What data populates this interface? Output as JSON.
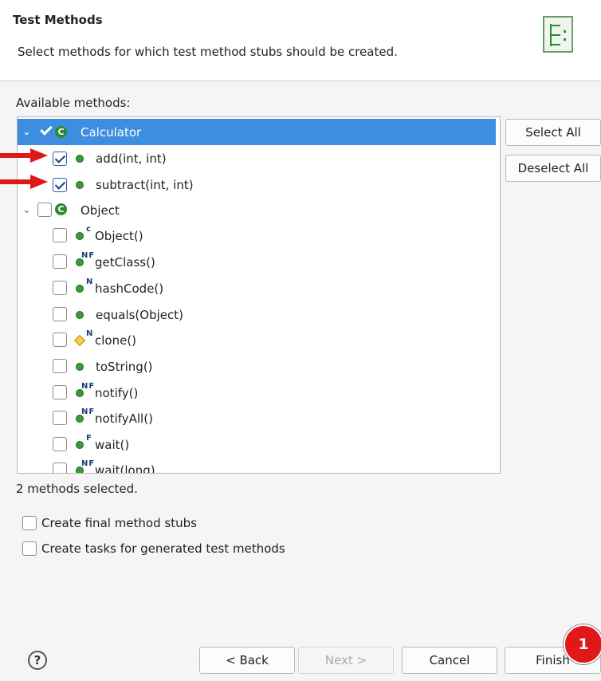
{
  "header": {
    "title": "Test Methods",
    "description": "Select methods for which test method stubs should be created."
  },
  "available_label": "Available methods:",
  "tree": [
    {
      "label": "Calculator",
      "kind": "class",
      "checked": true,
      "expanded": true,
      "selected": true
    },
    {
      "label": "add(int, int)",
      "kind": "method",
      "checked": true
    },
    {
      "label": "subtract(int, int)",
      "kind": "method",
      "checked": true
    },
    {
      "label": "Object",
      "kind": "class",
      "checked": false,
      "expanded": true
    },
    {
      "label": "Object()",
      "kind": "method",
      "checked": false,
      "modifier": "c"
    },
    {
      "label": "getClass()",
      "kind": "method",
      "checked": false,
      "modifier": "NF"
    },
    {
      "label": "hashCode()",
      "kind": "method",
      "checked": false,
      "modifier": "N"
    },
    {
      "label": "equals(Object)",
      "kind": "method",
      "checked": false
    },
    {
      "label": "clone()",
      "kind": "method",
      "checked": false,
      "modifier": "N",
      "protected": true
    },
    {
      "label": "toString()",
      "kind": "method",
      "checked": false
    },
    {
      "label": "notify()",
      "kind": "method",
      "checked": false,
      "modifier": "NF"
    },
    {
      "label": "notifyAll()",
      "kind": "method",
      "checked": false,
      "modifier": "NF"
    },
    {
      "label": "wait()",
      "kind": "method",
      "checked": false,
      "modifier": "F"
    },
    {
      "label": "wait(long)",
      "kind": "method",
      "checked": false,
      "modifier": "NF"
    }
  ],
  "side_buttons": {
    "select_all": "Select All",
    "deselect_all": "Deselect All"
  },
  "status": "2 methods selected.",
  "options": {
    "final_stubs": "Create final method stubs",
    "tasks": "Create tasks for generated test methods"
  },
  "footer": {
    "help": "?",
    "back": "< Back",
    "next": "Next >",
    "cancel": "Cancel",
    "finish": "Finish",
    "badge": "1"
  },
  "colors": {
    "selection": "#3d8ee0",
    "annotation_red": "#e01818"
  },
  "icons": {
    "class": "class-icon",
    "method": "public-method-icon",
    "protected": "protected-method-icon"
  }
}
